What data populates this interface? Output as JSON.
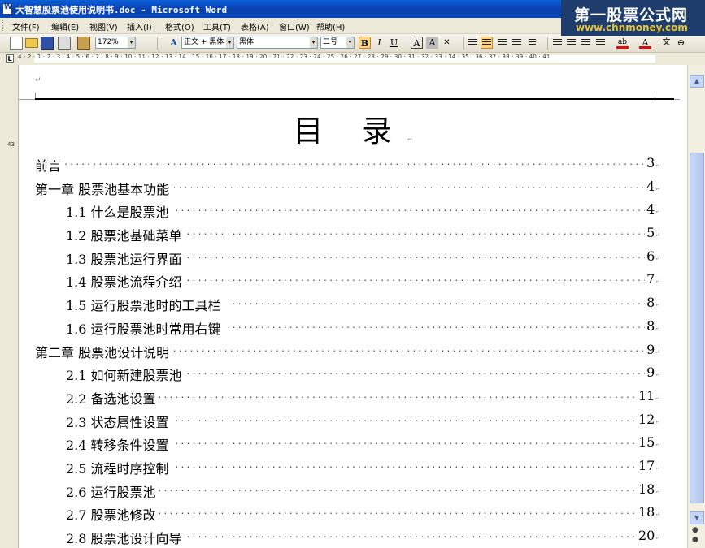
{
  "window": {
    "title": "大智慧股票池使用说明书.doc - Microsoft Word"
  },
  "watermark": {
    "line1": "第一股票公式网",
    "line2": "www.chnmoney.com"
  },
  "menu": [
    "文件(F)",
    "编辑(E)",
    "视图(V)",
    "插入(I)",
    "格式(O)",
    "工具(T)",
    "表格(A)",
    "窗口(W)",
    "帮助(H)"
  ],
  "toolbar": {
    "zoom": "172%",
    "style": "正文 + 黑体",
    "font": "黑体",
    "size": "二号",
    "bold_label": "B",
    "italic_label": "I",
    "underline_label": "U",
    "char_border_label": "A",
    "char_shade_label": "A",
    "font_color_label": "A",
    "highlight_label": "ab",
    "phonetic_label": "文"
  },
  "ruler": {
    "box_label": "L",
    "numbers": "4 · 2 · 1 · 2 · 3 · 4 · 5 · 6 · 7 · 8 · 9 · 10 · 11 · 12 · 13 · 14 · 15 · 16 · 17 · 18 · 19 · 20 · 21 · 22 · 23 · 24 · 25 · 26 · 27 · 28 · 29 · 30 · 31 · 32 · 33 · 34 · 35 · 36 · 37 · 38 · 39 · 40 · 41",
    "vertical_number": "43"
  },
  "document": {
    "title": "目 录",
    "paragraph_mark": "↵",
    "toc": [
      {
        "text": "前言",
        "page": "3",
        "level": 1
      },
      {
        "text": "第一章  股票池基本功能",
        "page": "4",
        "level": 1
      },
      {
        "text": "1.1 什么是股票池",
        "page": "4",
        "level": 2
      },
      {
        "text": "1.2 股票池基础菜单",
        "page": "5",
        "level": 2
      },
      {
        "text": "1.3  股票池运行界面",
        "page": "6",
        "level": 2
      },
      {
        "text": "1.4  股票池流程介绍",
        "page": "7",
        "level": 2
      },
      {
        "text": "1.5 运行股票池时的工具栏",
        "page": "8",
        "level": 2
      },
      {
        "text": "1.6  运行股票池时常用右键",
        "page": "8",
        "level": 2
      },
      {
        "text": "第二章  股票池设计说明",
        "page": "9",
        "level": 1
      },
      {
        "text": "2.1  如何新建股票池",
        "page": "9",
        "level": 2
      },
      {
        "text": "2.2  备选池设置",
        "page": "11",
        "level": 2
      },
      {
        "text": "2.3  状态属性设置",
        "page": "12",
        "level": 2
      },
      {
        "text": "2.4  转移条件设置",
        "page": "15",
        "level": 2
      },
      {
        "text": "2.5  流程时序控制",
        "page": "17",
        "level": 2
      },
      {
        "text": "2.6  运行股票池",
        "page": "18",
        "level": 2
      },
      {
        "text": "2.7  股票池修改",
        "page": "18",
        "level": 2
      },
      {
        "text": "2.8  股票池设计向导",
        "page": "20",
        "level": 2
      }
    ],
    "dot_leader": "......................................................................................................................................................."
  }
}
